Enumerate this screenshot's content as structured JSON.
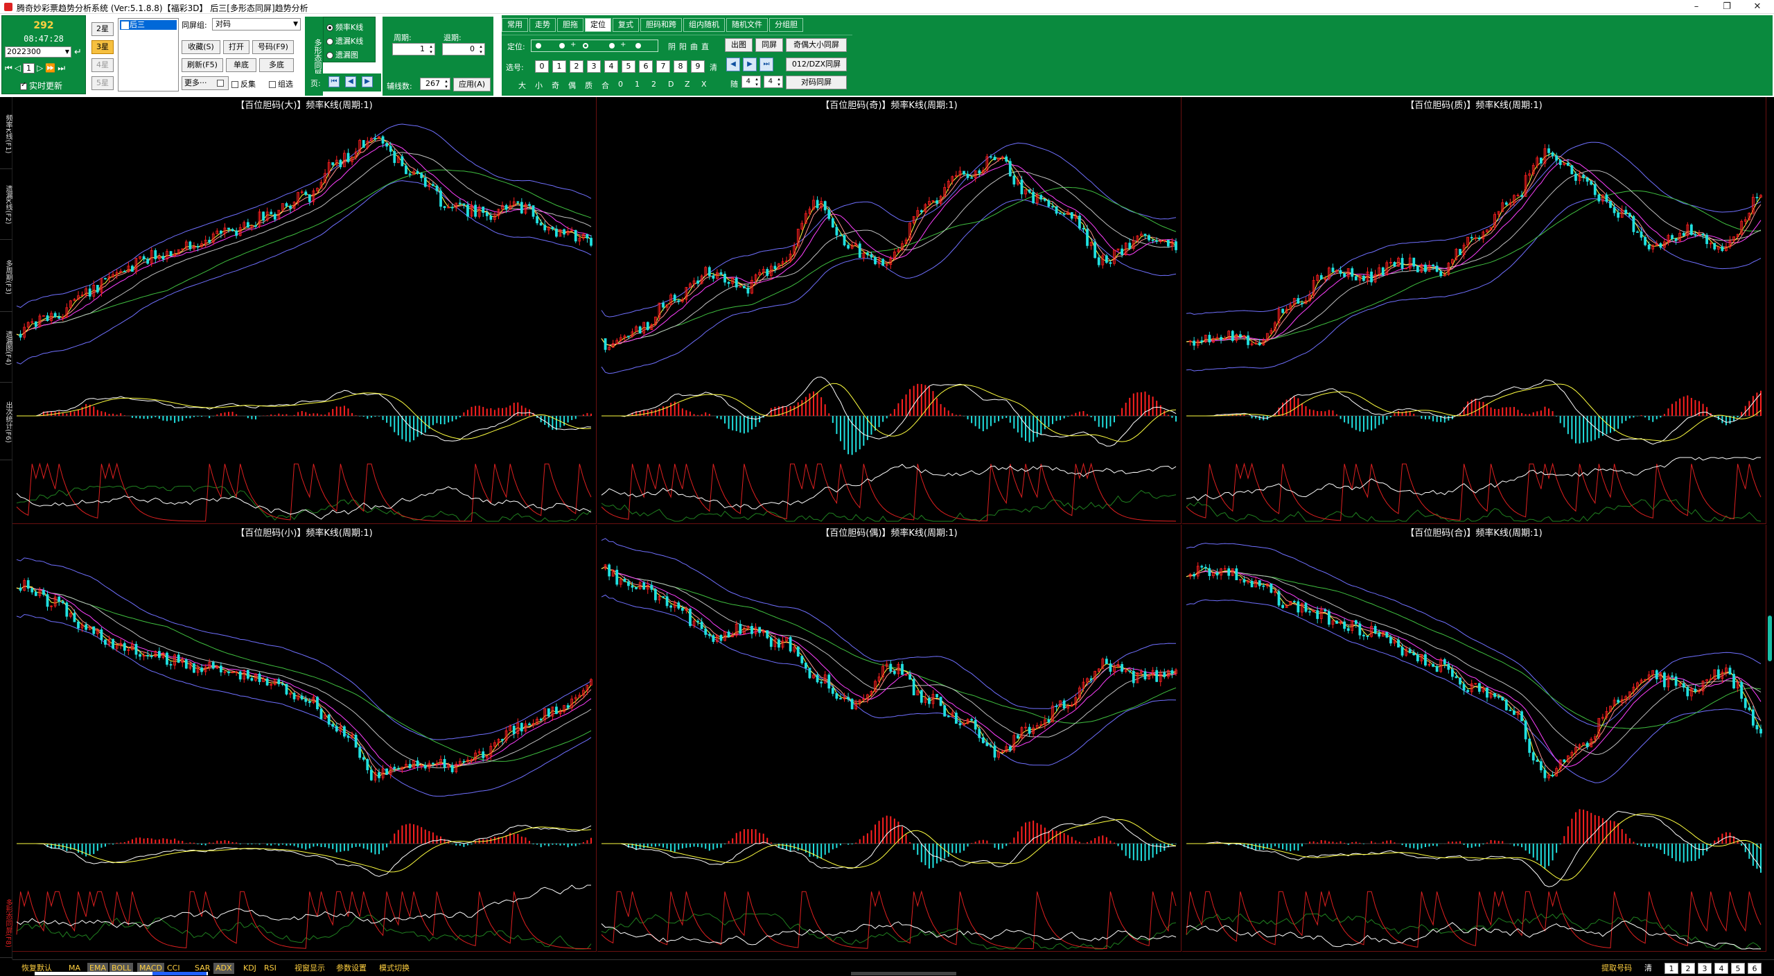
{
  "window": {
    "title": "腾奇妙彩票趋势分析系统 (Ver:5.1.8.8)【福彩3D】  后三[多形态同屏]趋势分析",
    "minimize": "–",
    "restore": "❐",
    "close": "✕"
  },
  "clock": {
    "number": "292",
    "time": "08:47:28",
    "issue": "2022300",
    "nav_page": "1",
    "auto_update": "实时更新",
    "auto_update_checked": true
  },
  "stars": [
    {
      "label": "2星",
      "state": "normal"
    },
    {
      "label": "3星",
      "state": "active"
    },
    {
      "label": "4星",
      "state": "disabled"
    },
    {
      "label": "5星",
      "state": "disabled"
    }
  ],
  "list": {
    "selected": "后三"
  },
  "group": {
    "label": "同屏组:",
    "value": "对码",
    "buttons": [
      "收藏(S)",
      "打开",
      "号码(F9)",
      "刷新(F5)",
      "单底",
      "多底"
    ],
    "more": "更多···",
    "checks": [
      {
        "label": "反集",
        "checked": false
      },
      {
        "label": "组选",
        "checked": false
      }
    ]
  },
  "morph": {
    "label": "多形态同屏"
  },
  "chart_types": [
    {
      "label": "频率K线",
      "selected": true
    },
    {
      "label": "遗漏K线",
      "selected": false
    },
    {
      "label": "遗漏图",
      "selected": false
    }
  ],
  "pager": {
    "label": "页:",
    "buttons": [
      "⏮",
      "◀",
      "▶"
    ]
  },
  "period": {
    "period_label": "周期:",
    "period_value": "1",
    "back_label": "退期:",
    "back_value": "0",
    "count_label": "辅线数:",
    "count_value": "267",
    "apply": "应用(A)"
  },
  "tabs": [
    {
      "label": "常用",
      "active": false
    },
    {
      "label": "走势",
      "active": false
    },
    {
      "label": "胆拖",
      "active": false
    },
    {
      "label": "定位",
      "active": true
    },
    {
      "label": "复式",
      "active": false
    },
    {
      "label": "胆码和跨",
      "active": false
    },
    {
      "label": "组内随机",
      "active": false
    },
    {
      "label": "随机文件",
      "active": false
    },
    {
      "label": "分组胆",
      "active": false
    }
  ],
  "position": {
    "label": "定位:",
    "marks": [
      "",
      "",
      "+",
      "",
      "+"
    ],
    "attrs": [
      "阴",
      "阳",
      "曲",
      "直"
    ],
    "select_label": "选号:",
    "digits": [
      "0",
      "1",
      "2",
      "3",
      "4",
      "5",
      "6",
      "7",
      "8",
      "9"
    ],
    "clear": "清",
    "props": [
      "大",
      "小",
      "奇",
      "偶",
      "质",
      "合",
      "0",
      "1",
      "2",
      "D",
      "Z",
      "X"
    ],
    "buttons": [
      "出图",
      "同屏",
      "奇偶大小同屏",
      "012/DZX同屏",
      "对码同屏"
    ],
    "random_label": "随",
    "random_a": "4",
    "random_b": "4"
  },
  "side_tabs": [
    {
      "label": "频率K线(F1)",
      "active": false
    },
    {
      "label": "遗漏K线(F2)",
      "active": false
    },
    {
      "label": "多周期(F3)",
      "active": false
    },
    {
      "label": "遗漏图(F4)",
      "active": false
    },
    {
      "label": "出次统计(F6)",
      "active": false
    },
    {
      "label": "多形态同屏(F8)",
      "active": true
    }
  ],
  "panels": [
    {
      "title": "【百位胆码(大)】频率K线(周期:1)",
      "seed": 11,
      "shape": [
        0.85,
        0.78,
        0.68,
        0.58,
        0.52,
        0.47,
        0.42,
        0.36,
        0.28,
        0.12,
        0.02,
        0.18,
        0.3,
        0.35,
        0.32,
        0.42,
        0.46
      ]
    },
    {
      "title": "【百位胆码(奇)】频率K线(周期:1)",
      "seed": 23,
      "shape": [
        0.9,
        0.85,
        0.7,
        0.6,
        0.66,
        0.55,
        0.3,
        0.5,
        0.55,
        0.32,
        0.18,
        0.12,
        0.28,
        0.35,
        0.55,
        0.45,
        0.48
      ]
    },
    {
      "title": "【百位胆码(质)】频率K线(周期:1)",
      "seed": 37,
      "shape": [
        0.88,
        0.86,
        0.88,
        0.72,
        0.6,
        0.62,
        0.55,
        0.6,
        0.45,
        0.3,
        0.1,
        0.2,
        0.35,
        0.48,
        0.42,
        0.5,
        0.28
      ]
    },
    {
      "title": "【百位胆码(小)】频率K线(周期:1)",
      "seed": 41,
      "shape": [
        0.1,
        0.18,
        0.3,
        0.38,
        0.42,
        0.45,
        0.48,
        0.52,
        0.58,
        0.72,
        0.92,
        0.86,
        0.88,
        0.82,
        0.72,
        0.64,
        0.52
      ]
    },
    {
      "title": "【百位胆码(偶)】频率K线(周期:1)",
      "seed": 53,
      "shape": [
        0.05,
        0.12,
        0.2,
        0.32,
        0.3,
        0.35,
        0.5,
        0.62,
        0.45,
        0.58,
        0.68,
        0.82,
        0.72,
        0.6,
        0.45,
        0.5,
        0.48
      ]
    },
    {
      "title": "【百位胆码(合)】频率K线(周期:1)",
      "seed": 67,
      "shape": [
        0.05,
        0.05,
        0.12,
        0.2,
        0.25,
        0.3,
        0.38,
        0.45,
        0.55,
        0.62,
        0.92,
        0.78,
        0.62,
        0.5,
        0.55,
        0.48,
        0.72
      ]
    }
  ],
  "status": {
    "items": [
      {
        "label": "恢复默认",
        "boxed": false
      },
      {
        "label": "MA",
        "boxed": false
      },
      {
        "label": "EMA",
        "boxed": true
      },
      {
        "label": "BOLL",
        "boxed": true
      },
      {
        "label": "MACD",
        "boxed": true
      },
      {
        "label": "CCI",
        "boxed": false
      },
      {
        "label": "SAR",
        "boxed": false
      },
      {
        "label": "ADX",
        "boxed": true
      },
      {
        "label": "KDJ",
        "boxed": false
      },
      {
        "label": "RSI",
        "boxed": false
      },
      {
        "label": "视窗显示",
        "boxed": false
      },
      {
        "label": "参数设置",
        "boxed": false
      },
      {
        "label": "模式切换",
        "boxed": false
      }
    ],
    "right_label": "提取号码",
    "clear_label": "清",
    "pages": [
      "1",
      "2",
      "3",
      "4",
      "5",
      "6"
    ]
  },
  "colors": {
    "panel_green": "#0a8a3e",
    "candle_up": "#ff2020",
    "candle_down": "#20e0e0",
    "boll": "#7070ff",
    "ma_fast": "#ffff40",
    "ma_mid": "#ff40ff",
    "ma_slow": "#40c040",
    "accent_red": "#e02020"
  }
}
